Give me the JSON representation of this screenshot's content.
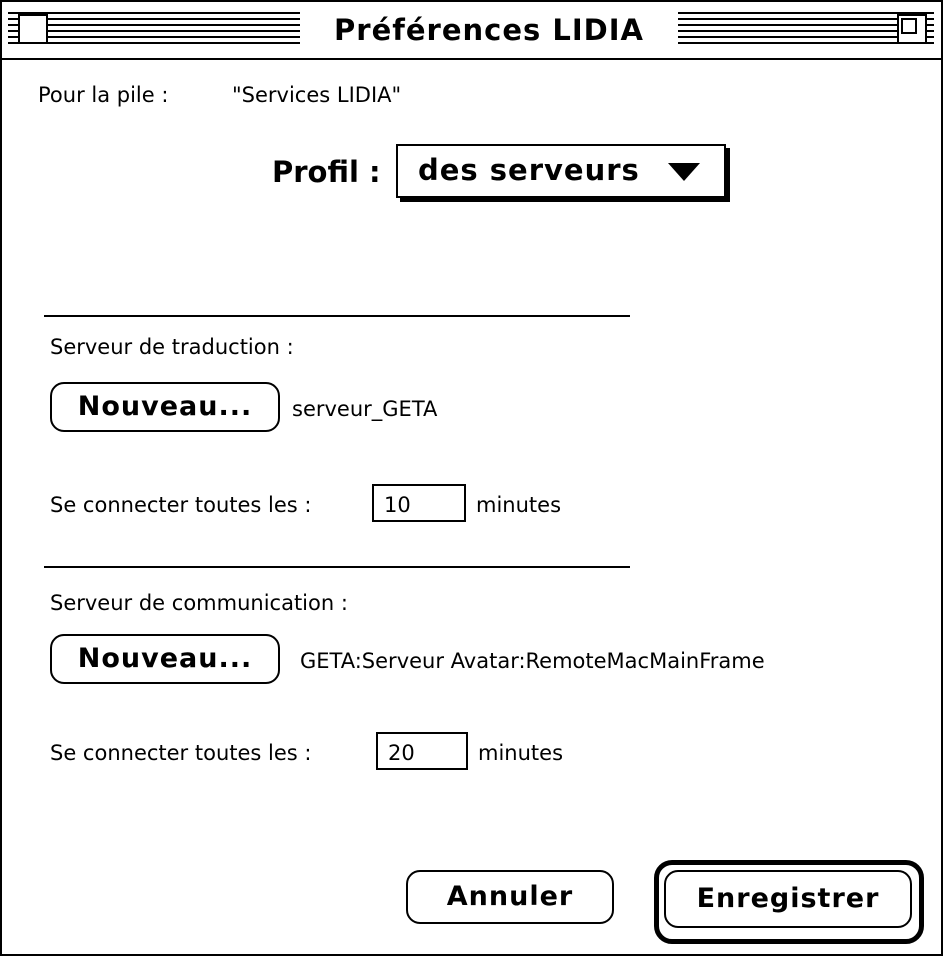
{
  "window": {
    "title": "Préférences LIDIA"
  },
  "stack": {
    "label": "Pour la pile :",
    "value": "\"Services LIDIA\""
  },
  "profile": {
    "label": "Profil :",
    "selected": "des serveurs"
  },
  "translation_server": {
    "label": "Serveur de traduction :",
    "button": "Nouveau...",
    "name": "serveur_GETA",
    "interval_label": "Se connecter toutes les :",
    "interval_value": "10",
    "unit": "minutes"
  },
  "communication_server": {
    "label": "Serveur de communication :",
    "button": "Nouveau...",
    "name": "GETA:Serveur Avatar:RemoteMacMainFrame",
    "interval_label": "Se connecter toutes les :",
    "interval_value": "20",
    "unit": "minutes"
  },
  "footer": {
    "cancel": "Annuler",
    "save": "Enregistrer"
  },
  "icons": [
    "close-box-icon",
    "zoom-box-icon",
    "dropdown-arrow-icon"
  ]
}
